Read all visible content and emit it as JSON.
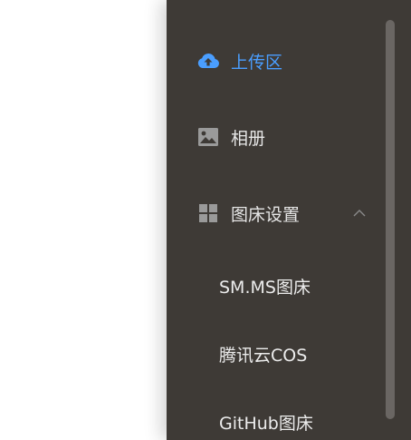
{
  "sidebar": {
    "items": [
      {
        "label": "上传区",
        "icon": "cloud-upload-icon",
        "active": true
      },
      {
        "label": "相册",
        "icon": "image-icon",
        "active": false
      },
      {
        "label": "图床设置",
        "icon": "grid-icon",
        "active": false,
        "expanded": true
      }
    ],
    "sub_items": [
      {
        "label": "SM.MS图床"
      },
      {
        "label": "腾讯云COS"
      },
      {
        "label": "GitHub图床"
      }
    ]
  },
  "colors": {
    "sidebar_bg": "#3e3a36",
    "active": "#4a9eff",
    "text": "#e6e6e6",
    "icon": "#9a9a9a",
    "scrollbar": "#6a6663"
  }
}
